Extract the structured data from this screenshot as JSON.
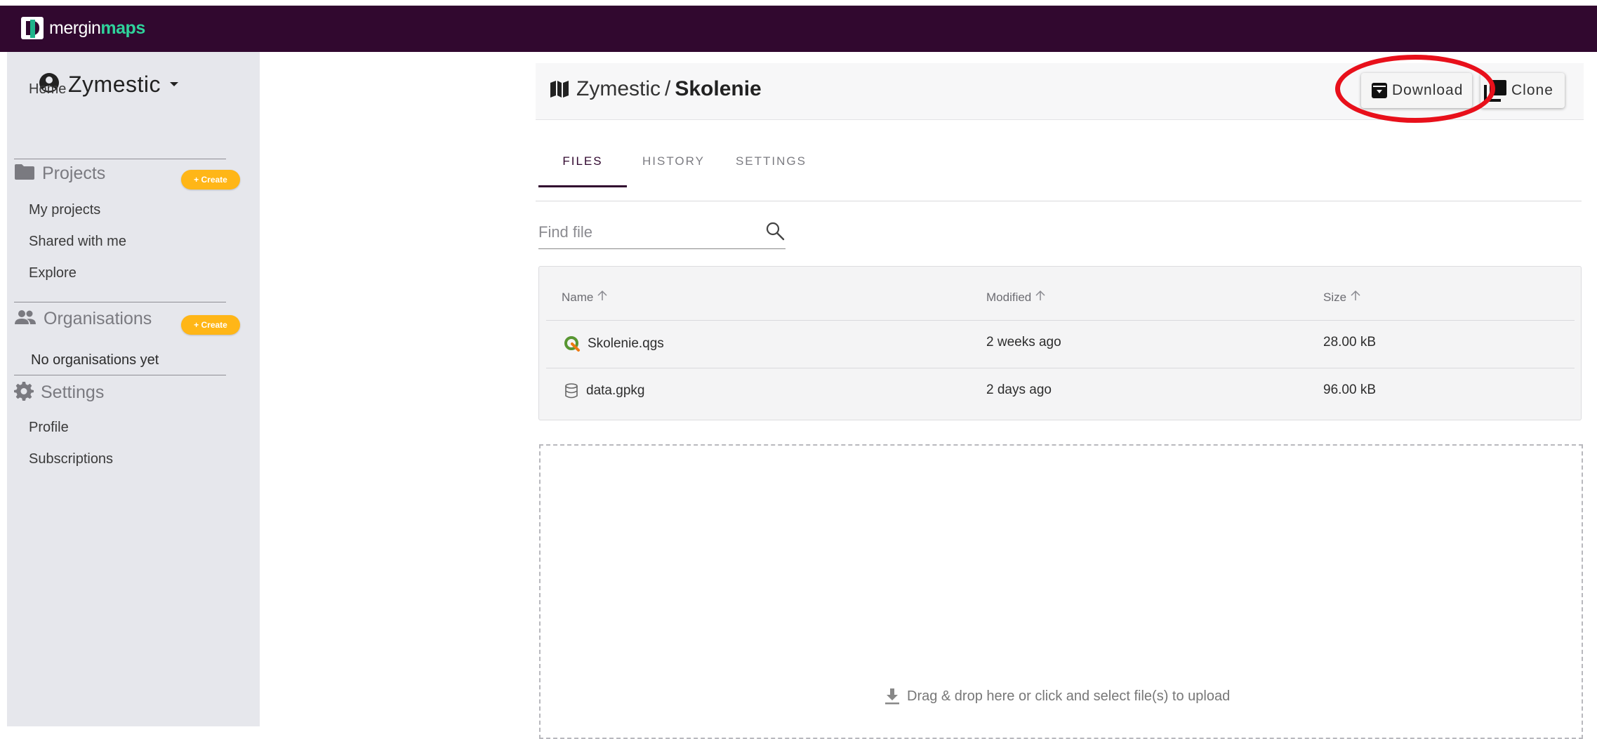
{
  "app": {
    "logo_text_a": "mergin",
    "logo_text_b": "maps"
  },
  "sidebar": {
    "user_name": "Zymestic",
    "home": "Home",
    "projects_label": "Projects",
    "projects_create": "+ Create",
    "projects_items": [
      "My projects",
      "Shared with me",
      "Explore"
    ],
    "organisations_label": "Organisations",
    "organisations_create": "+ Create",
    "organisations_empty": "No organisations yet",
    "settings_label": "Settings",
    "settings_items": [
      "Profile",
      "Subscriptions"
    ]
  },
  "header": {
    "namespace": "Zymestic",
    "separator": "/",
    "project": "Skolenie",
    "download_label": "Download",
    "clone_label": "Clone"
  },
  "tabs": [
    {
      "label": "FILES",
      "active": true
    },
    {
      "label": "HISTORY",
      "active": false
    },
    {
      "label": "SETTINGS",
      "active": false
    }
  ],
  "search": {
    "placeholder": "Find file"
  },
  "files_table": {
    "columns": [
      "Name",
      "Modified",
      "Size"
    ],
    "rows": [
      {
        "name": "Skolenie.qgs",
        "modified": "2 weeks ago",
        "size": "28.00 kB",
        "icon": "qgis-icon"
      },
      {
        "name": "data.gpkg",
        "modified": "2 days ago",
        "size": "96.00 kB",
        "icon": "database-icon"
      }
    ]
  },
  "upload": {
    "message": "Drag & drop here or click and select file(s) to upload"
  },
  "colors": {
    "topbar": "#31082f",
    "brand_green": "#2fd39b",
    "create_button": "#ffb617",
    "highlight": "#e8101b"
  }
}
